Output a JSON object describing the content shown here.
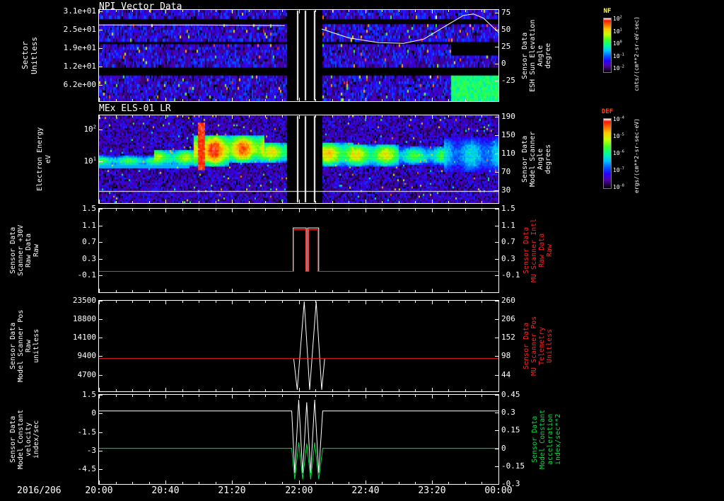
{
  "figure": {
    "date_label": "2016/206",
    "x_tick_labels": [
      "20:00",
      "20:40",
      "21:20",
      "22:00",
      "22:40",
      "23:20",
      "00:00"
    ],
    "x_range_hours": [
      0,
      4
    ],
    "background_color": "#000000"
  },
  "colorbars": [
    {
      "id": "nf",
      "label": "NF",
      "label_color": "#ffff66",
      "tick_labels": [
        "10^2",
        "10^1",
        "10^0",
        "10^-1",
        "10^-2"
      ],
      "units": "cnts/(cm**2-sr-eV-sec)"
    },
    {
      "id": "def",
      "label": "DEF",
      "label_color": "#ff4422",
      "tick_labels": [
        "10^-4",
        "10^-5",
        "10^-6",
        "10^-7",
        "10^-8"
      ],
      "units": "ergs/(cm**2-sr-sec-eV)"
    }
  ],
  "chart_data": [
    {
      "id": "npi",
      "type": "heatmap",
      "title": "NPI Vector Data",
      "left_axis": {
        "labels": [
          "Sector",
          "Unitless"
        ],
        "tick_labels": [
          "3.1e+01",
          "2.5e+01",
          "1.9e+01",
          "1.2e+01",
          "6.2e+00"
        ]
      },
      "right_axis": {
        "labels": [
          "Sensor Data",
          "ESH Sun Elevation",
          "Angle",
          "degree"
        ],
        "ticks": [
          75,
          50,
          25,
          0,
          -25
        ],
        "range": [
          79,
          -55
        ]
      },
      "spec": {
        "seed": 7,
        "rows": 32,
        "base": [
          0.05,
          0.3
        ],
        "black_speck": 0.05,
        "hot_speck": 0.02,
        "black_bands": [
          [
            0.1,
            0.155
          ],
          [
            0.33,
            0.375
          ],
          [
            0.615,
            0.72
          ]
        ],
        "gaps": [
          [
            1.88,
            2.23
          ]
        ],
        "bright_columns": [
          1.98,
          2.06,
          2.15
        ],
        "blob": {
          "t": [
            3.52,
            4.0
          ],
          "row": [
            0.73,
            1.0
          ],
          "value": 0.46
        },
        "right_black": {
          "t": [
            3.52,
            4.0
          ],
          "row": [
            0.33,
            0.5
          ]
        }
      },
      "overlay_series": [
        {
          "name": "sun-elevation-angle",
          "color": "#ffffff",
          "axis": "right",
          "points": [
            [
              0,
              57
            ],
            [
              1.0,
              57
            ],
            [
              1.86,
              56
            ]
          ]
        },
        {
          "name": "sun-elevation-angle",
          "color": "#ffffff",
          "axis": "right",
          "points": [
            [
              2.23,
              51
            ],
            [
              2.5,
              38
            ],
            [
              2.8,
              31
            ],
            [
              3.05,
              30
            ],
            [
              3.25,
              36
            ],
            [
              3.5,
              58
            ],
            [
              3.65,
              71
            ],
            [
              3.75,
              73
            ],
            [
              3.85,
              67
            ],
            [
              4.0,
              46
            ]
          ]
        }
      ]
    },
    {
      "id": "els",
      "type": "heatmap",
      "title": "MEx ELS-01 LR",
      "left_axis": {
        "labels": [
          "Electron Energy",
          "eV"
        ],
        "tick_labels": [
          "10^2",
          "10^1"
        ],
        "tick_y_frac": [
          0.161,
          0.524
        ]
      },
      "right_axis": {
        "labels": [
          "Sensor Data",
          "Model Scanner",
          "Angle",
          "degrees"
        ],
        "tick_labels": [
          "190",
          "150",
          "110",
          "70",
          "30"
        ]
      },
      "spec": {
        "seed": 12,
        "rows": 48,
        "base": [
          0.04,
          0.26
        ],
        "black_speck": 0.05,
        "hot_speck": 0.015,
        "gaps": [
          [
            1.88,
            2.23
          ]
        ],
        "bright_columns": [
          1.98,
          2.06,
          2.15
        ],
        "band_width": 0.105,
        "band_segments": [
          {
            "t": [
              0,
              0.55
            ],
            "i": 0.6,
            "w": 0.55,
            "c": 0.52
          },
          {
            "t": [
              0.55,
              0.95
            ],
            "i": 0.68,
            "w": 0.9,
            "c": 0.48
          },
          {
            "t": [
              0.95,
              1.3
            ],
            "i": 0.97,
            "w": 1.7,
            "c": 0.4
          },
          {
            "t": [
              1.3,
              1.65
            ],
            "i": 0.92,
            "w": 1.5,
            "c": 0.38
          },
          {
            "t": [
              1.65,
              1.88
            ],
            "i": 0.76,
            "w": 1.1,
            "c": 0.42
          },
          {
            "t": [
              2.23,
              2.55
            ],
            "i": 0.8,
            "w": 1.3,
            "c": 0.44
          },
          {
            "t": [
              2.55,
              3.0
            ],
            "i": 0.75,
            "w": 1.2,
            "c": 0.45
          },
          {
            "t": [
              3.0,
              3.45
            ],
            "i": 0.58,
            "w": 1.0,
            "c": 0.46
          },
          {
            "t": [
              3.45,
              4.0
            ],
            "i": 0.45,
            "w": 1.9,
            "c": 0.45
          }
        ],
        "flare": {
          "t": 1.03,
          "halfwidth": 0.035,
          "row": [
            0.08,
            0.62
          ],
          "value": 0.9
        },
        "low_line": {
          "t": [
            0,
            0.9
          ],
          "row": 0.58,
          "value": 0.38
        },
        "white_line_row": 0.865
      }
    },
    {
      "id": "scanner-30v",
      "type": "line",
      "left_axis": {
        "labels": [
          "Sensor Data",
          "Scanner +30V",
          "Raw Data",
          "Raw"
        ],
        "ticks": [
          1.5,
          1.1,
          0.7,
          0.3,
          -0.1
        ],
        "range": [
          1.5,
          -0.5
        ]
      },
      "right_axis": {
        "labels": [
          "Sensor Data",
          "MU Scanner Intl",
          "Raw Data",
          "Raw"
        ],
        "ticks": [
          1.5,
          1.1,
          0.7,
          0.3,
          -0.1
        ],
        "range": [
          1.5,
          -0.5
        ],
        "color": "#ff2222"
      },
      "series": [
        {
          "name": "scanner-plus-30v-raw",
          "color": "#ffffff",
          "axis": "left",
          "points": [
            [
              0,
              0
            ],
            [
              1.945,
              0
            ],
            [
              1.945,
              1.04
            ],
            [
              2.075,
              1.04
            ],
            [
              2.075,
              0
            ],
            [
              2.09,
              0
            ],
            [
              2.09,
              1.04
            ],
            [
              2.2,
              1.04
            ],
            [
              2.2,
              0
            ],
            [
              4,
              0
            ]
          ]
        },
        {
          "name": "mu-scanner-intl-raw",
          "color": "#ff2222",
          "axis": "right",
          "points": [
            [
              0,
              0
            ],
            [
              1.95,
              0
            ],
            [
              1.95,
              1.0
            ],
            [
              2.07,
              1.0
            ],
            [
              2.07,
              0
            ],
            [
              2.1,
              0
            ],
            [
              2.1,
              1.0
            ],
            [
              2.19,
              1.0
            ],
            [
              2.19,
              0
            ],
            [
              4,
              0
            ]
          ]
        }
      ]
    },
    {
      "id": "scanner-pos",
      "type": "line",
      "left_axis": {
        "labels": [
          "Sensor Data",
          "Model Scanner Pos",
          "Raw",
          "unitless"
        ],
        "ticks": [
          23500,
          18800,
          14100,
          9400,
          4700
        ],
        "range": [
          23500,
          500
        ]
      },
      "right_axis": {
        "labels": [
          "Sensor Data",
          "MU Scanner Pos",
          "Telemetry",
          "Unitless"
        ],
        "tick_labels": [
          "260",
          "206",
          "152",
          "98",
          "44"
        ],
        "color": "#ff2222"
      },
      "series": [
        {
          "name": "model-scanner-pos-raw",
          "color": "#ffffff",
          "axis": "left",
          "points": [
            [
              1.95,
              8800
            ],
            [
              1.985,
              900
            ],
            [
              2.055,
              23300
            ],
            [
              2.11,
              900
            ],
            [
              2.175,
              23300
            ],
            [
              2.23,
              900
            ],
            [
              2.26,
              8800
            ]
          ]
        },
        {
          "name": "mu-scanner-pos-telemetry",
          "color": "#ff2222",
          "axis": "left",
          "points": [
            [
              0,
              8800
            ],
            [
              4,
              8800
            ]
          ]
        }
      ]
    },
    {
      "id": "model-constant",
      "type": "line",
      "left_axis": {
        "labels": [
          "Sensor Data",
          "Model Constant",
          "velocity",
          "index/sec"
        ],
        "ticks": [
          1.5,
          0.0,
          -1.5,
          -3.0,
          -4.5
        ],
        "range": [
          1.5,
          -5.7
        ]
      },
      "right_axis": {
        "labels": [
          "Sensor Data",
          "Model Constant",
          "acceleration",
          "index/sec**2"
        ],
        "ticks": [
          0.45,
          0.3,
          0.15,
          0.0,
          -0.15,
          -0.3
        ],
        "range": [
          0.45,
          -0.3
        ],
        "color": "#00dd44"
      },
      "series": [
        {
          "name": "velocity",
          "color": "#ffffff",
          "axis": "left",
          "points": [
            [
              0,
              0.2
            ],
            [
              1.93,
              0.2
            ],
            [
              1.96,
              -4.8
            ],
            [
              2.0,
              1.1
            ],
            [
              2.04,
              -4.8
            ],
            [
              2.08,
              0.9
            ],
            [
              2.12,
              -4.8
            ],
            [
              2.16,
              1.1
            ],
            [
              2.2,
              -4.8
            ],
            [
              2.24,
              0.2
            ],
            [
              4,
              0.2
            ]
          ]
        },
        {
          "name": "acceleration",
          "color": "#00dd44",
          "axis": "right",
          "points": [
            [
              0,
              0
            ],
            [
              1.93,
              0
            ],
            [
              1.96,
              -0.26
            ],
            [
              2.0,
              0.05
            ],
            [
              2.04,
              -0.26
            ],
            [
              2.08,
              0.04
            ],
            [
              2.12,
              -0.26
            ],
            [
              2.16,
              0.05
            ],
            [
              2.2,
              -0.26
            ],
            [
              2.24,
              0
            ],
            [
              4,
              0
            ]
          ]
        }
      ]
    }
  ]
}
